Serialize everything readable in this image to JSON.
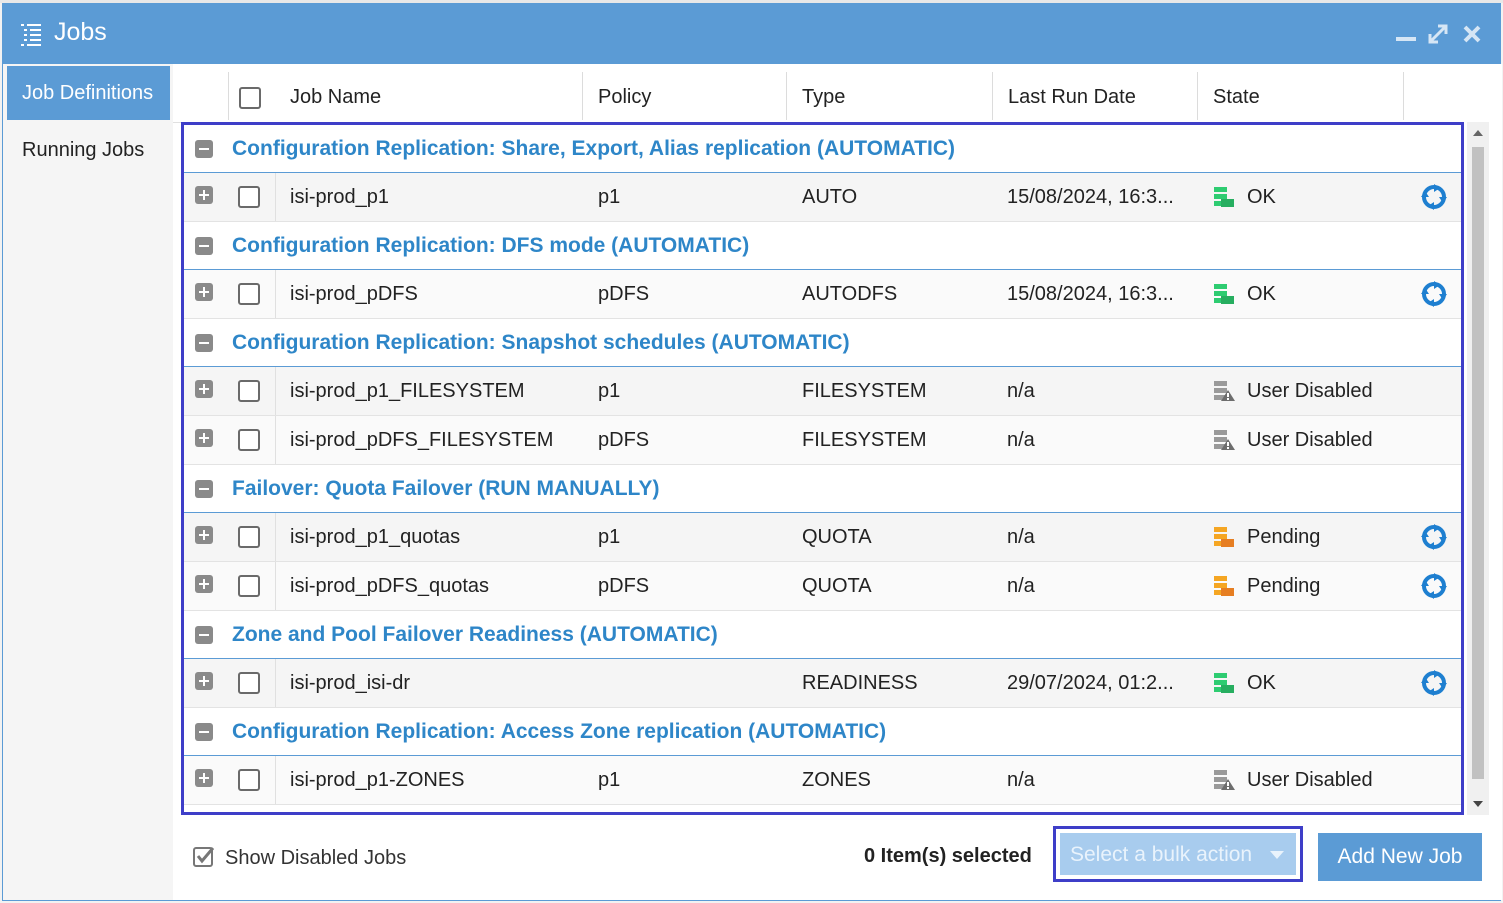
{
  "window": {
    "title": "Jobs"
  },
  "sidebar": {
    "items": [
      {
        "label": "Job Definitions"
      },
      {
        "label": "Running Jobs"
      }
    ]
  },
  "table": {
    "headers": {
      "job_name": "Job Name",
      "policy": "Policy",
      "type": "Type",
      "last_run_date": "Last Run Date",
      "state": "State"
    },
    "groups": [
      {
        "title": "Configuration Replication: Share, Export, Alias replication (AUTOMATIC)",
        "rows": [
          {
            "job_name": "isi-prod_p1",
            "policy": "p1",
            "type": "AUTO",
            "last_run": "15/08/2024, 16:3...",
            "state": "OK",
            "state_icon": "ok-state-icon"
          }
        ]
      },
      {
        "title": "Configuration Replication: DFS mode (AUTOMATIC)",
        "rows": [
          {
            "job_name": "isi-prod_pDFS",
            "policy": "pDFS",
            "type": "AUTODFS",
            "last_run": "15/08/2024, 16:3...",
            "state": "OK",
            "state_icon": "ok-state-icon"
          }
        ]
      },
      {
        "title": "Configuration Replication: Snapshot schedules (AUTOMATIC)",
        "rows": [
          {
            "job_name": "isi-prod_p1_FILESYSTEM",
            "policy": "p1",
            "type": "FILESYSTEM",
            "last_run": "n/a",
            "state": "User Disabled",
            "state_icon": "user-disabled-state-icon"
          },
          {
            "job_name": "isi-prod_pDFS_FILESYSTEM",
            "policy": "pDFS",
            "type": "FILESYSTEM",
            "last_run": "n/a",
            "state": "User Disabled",
            "state_icon": "user-disabled-state-icon"
          }
        ]
      },
      {
        "title": "Failover: Quota Failover (RUN MANUALLY)",
        "rows": [
          {
            "job_name": "isi-prod_p1_quotas",
            "policy": "p1",
            "type": "QUOTA",
            "last_run": "n/a",
            "state": "Pending",
            "state_icon": "pending-state-icon"
          },
          {
            "job_name": "isi-prod_pDFS_quotas",
            "policy": "pDFS",
            "type": "QUOTA",
            "last_run": "n/a",
            "state": "Pending",
            "state_icon": "pending-state-icon"
          }
        ]
      },
      {
        "title": "Zone and Pool Failover Readiness (AUTOMATIC)",
        "rows": [
          {
            "job_name": "isi-prod_isi-dr",
            "policy": "",
            "type": "READINESS",
            "last_run": "29/07/2024, 01:2...",
            "state": "OK",
            "state_icon": "ok-state-icon"
          }
        ]
      },
      {
        "title": "Configuration Replication: Access Zone replication (AUTOMATIC)",
        "rows": [
          {
            "job_name": "isi-prod_p1-ZONES",
            "policy": "p1",
            "type": "ZONES",
            "last_run": "n/a",
            "state": "User Disabled",
            "state_icon": "user-disabled-state-icon"
          }
        ]
      }
    ]
  },
  "footer": {
    "show_disabled_label": "Show Disabled Jobs",
    "show_disabled_checked": true,
    "selected_count": "0 Item(s) selected",
    "bulk_placeholder": "Select a bulk action",
    "add_button": "Add New Job"
  },
  "colors": {
    "accent": "#5b9bd5",
    "group_title": "#2e86c8",
    "highlight_border": "#3e3ec8",
    "ok": "#2ecc71",
    "pending": "#f5a623",
    "disabled": "#9a9a9a"
  }
}
